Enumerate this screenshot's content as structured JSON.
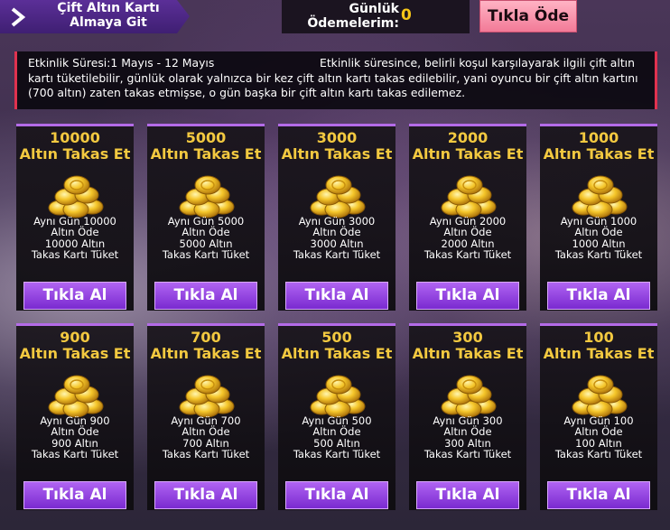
{
  "header": {
    "goto_label": "Çift Altın Kartı Almaya Git",
    "goto_icon": "chevron-right-icon",
    "daily_label": "Günlük Ödemelerim:",
    "daily_value": "0",
    "pay_button": "Tıkla Öde"
  },
  "info": {
    "period": "Etkinlik Süresi:1 Mayıs - 12 Mayıs",
    "text1": "Etkinlik süresince, belirli koşul karşılayarak ilgili çift altın kartı tüketilebilir, günlük olarak yalnızca bir kez çift altın kartı takas edilebilir, yani oyuncu bir çift altın kartını (700 altın) zaten takas etmişse, o gün başka bir çift altın kartı takas edilemez."
  },
  "colors": {
    "accent_purple": "#b46be8",
    "gold_text": "#f3c940",
    "pay_pink": "#f27a97"
  },
  "cards": [
    {
      "amount": "10000",
      "title": "Altın Takas Et",
      "line1": "Aynı Gün 10000",
      "line2": "Altın Öde",
      "line3": "10000 Altın",
      "line4": "Takas Kartı Tüket",
      "button": "Tıkla Al"
    },
    {
      "amount": "5000",
      "title": "Altın Takas Et",
      "line1": "Aynı Gün 5000",
      "line2": "Altın Öde",
      "line3": "5000 Altın",
      "line4": "Takas Kartı Tüket",
      "button": "Tıkla Al"
    },
    {
      "amount": "3000",
      "title": "Altın Takas Et",
      "line1": "Aynı Gün 3000",
      "line2": "Altın Öde",
      "line3": "3000 Altın",
      "line4": "Takas Kartı Tüket",
      "button": "Tıkla Al"
    },
    {
      "amount": "2000",
      "title": "Altın Takas Et",
      "line1": "Aynı Gün 2000",
      "line2": "Altın Öde",
      "line3": "2000 Altın",
      "line4": "Takas Kartı Tüket",
      "button": "Tıkla Al"
    },
    {
      "amount": "1000",
      "title": "Altın Takas Et",
      "line1": "Aynı Gün 1000",
      "line2": "Altın Öde",
      "line3": "1000 Altın",
      "line4": "Takas Kartı Tüket",
      "button": "Tıkla Al"
    },
    {
      "amount": "900",
      "title": "Altın Takas Et",
      "line1": "Aynı Gün 900",
      "line2": "Altın Öde",
      "line3": "900 Altın",
      "line4": "Takas Kartı Tüket",
      "button": "Tıkla Al"
    },
    {
      "amount": "700",
      "title": "Altın Takas Et",
      "line1": "Aynı Gün 700",
      "line2": "Altın Öde",
      "line3": "700 Altın",
      "line4": "Takas Kartı Tüket",
      "button": "Tıkla Al"
    },
    {
      "amount": "500",
      "title": "Altın Takas Et",
      "line1": "Aynı Gün 500",
      "line2": "Altın Öde",
      "line3": "500 Altın",
      "line4": "Takas Kartı Tüket",
      "button": "Tıkla Al"
    },
    {
      "amount": "300",
      "title": "Altın Takas Et",
      "line1": "Aynı Gün 300",
      "line2": "Altın Öde",
      "line3": "300 Altın",
      "line4": "Takas Kartı Tüket",
      "button": "Tıkla Al"
    },
    {
      "amount": "100",
      "title": "Altın Takas Et",
      "line1": "Aynı Gün 100",
      "line2": "Altın Öde",
      "line3": "100 Altın",
      "line4": "Takas Kartı Tüket",
      "button": "Tıkla Al"
    }
  ]
}
